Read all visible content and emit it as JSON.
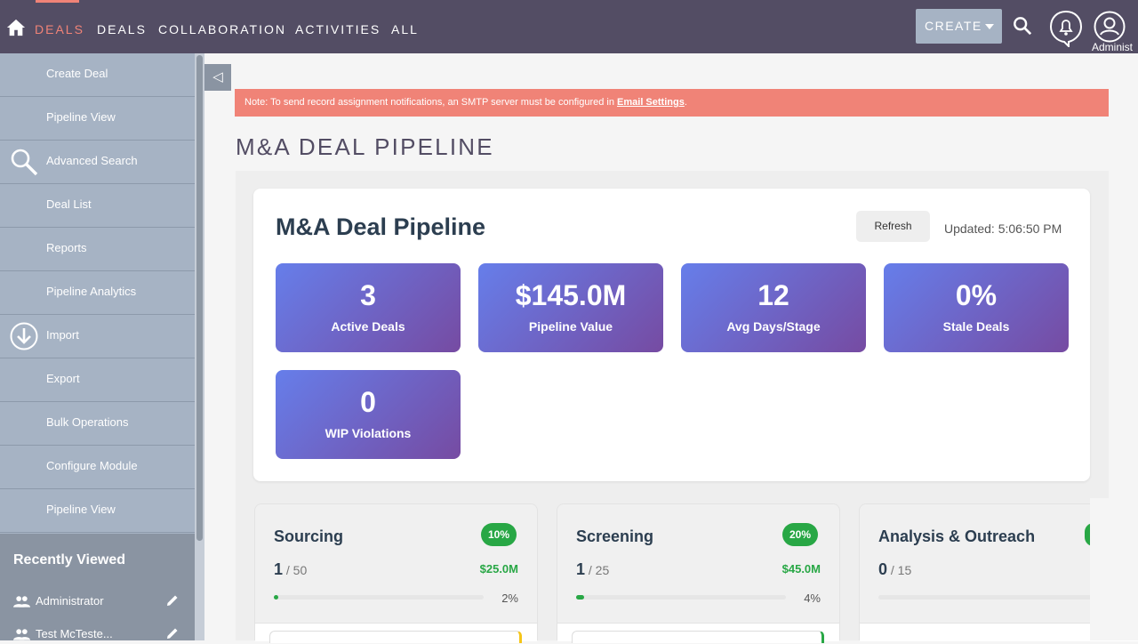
{
  "nav": {
    "items": [
      {
        "label": "DEALS",
        "active": true
      },
      {
        "label": "DEALS",
        "active": false
      },
      {
        "label": "COLLABORATION",
        "active": false
      },
      {
        "label": "ACTIVITIES",
        "active": false
      },
      {
        "label": "ALL",
        "active": false
      }
    ],
    "create_label": "CREATE",
    "user_label": "Administ"
  },
  "sidebar": {
    "items": [
      {
        "label": "Create Deal",
        "icon": ""
      },
      {
        "label": "Pipeline View",
        "icon": ""
      },
      {
        "label": "Advanced Search",
        "icon": "search-icon"
      },
      {
        "label": "Deal List",
        "icon": ""
      },
      {
        "label": "Reports",
        "icon": ""
      },
      {
        "label": "Pipeline Analytics",
        "icon": ""
      },
      {
        "label": "Import",
        "icon": "download-icon"
      },
      {
        "label": "Export",
        "icon": ""
      },
      {
        "label": "Bulk Operations",
        "icon": ""
      },
      {
        "label": "Configure Module",
        "icon": ""
      },
      {
        "label": "Pipeline View",
        "icon": ""
      }
    ],
    "recently_viewed_title": "Recently Viewed",
    "recent": [
      {
        "label": "Administrator"
      },
      {
        "label": "Test McTeste..."
      }
    ]
  },
  "alert": {
    "text": "Note: To send record assignment notifications, an SMTP server must be configured in ",
    "link": "Email Settings",
    "suffix": "."
  },
  "page_title": "M&A DEAL PIPELINE",
  "dashboard": {
    "title": "M&A Deal Pipeline",
    "refresh_label": "Refresh",
    "updated": "Updated: 5:06:50 PM",
    "stats": [
      {
        "value": "3",
        "label": "Active Deals"
      },
      {
        "value": "$145.0M",
        "label": "Pipeline Value"
      },
      {
        "value": "12",
        "label": "Avg Days/Stage"
      },
      {
        "value": "0%",
        "label": "Stale Deals"
      },
      {
        "value": "0",
        "label": "WIP Violations"
      }
    ]
  },
  "stages": [
    {
      "name": "Sourcing",
      "badge": "10%",
      "count": "1",
      "capacity": " / 50",
      "value": "$25.0M",
      "pct": "2%",
      "fill": 0.02,
      "stub_color": "#f5c518"
    },
    {
      "name": "Screening",
      "badge": "20%",
      "count": "1",
      "capacity": " / 25",
      "value": "$45.0M",
      "pct": "4%",
      "fill": 0.04,
      "stub_color": "#28a745"
    },
    {
      "name": "Analysis & Outreach",
      "badge": "",
      "count": "0",
      "capacity": " / 15",
      "value": "",
      "pct": "",
      "fill": 0,
      "stub_color": ""
    }
  ],
  "colors": {
    "navbar": "#534d64",
    "accent": "#f08377",
    "sidebar": "#a6b3c4",
    "stat_gradient_start": "#667eea",
    "stat_gradient_end": "#764ba2",
    "success": "#28a745"
  }
}
